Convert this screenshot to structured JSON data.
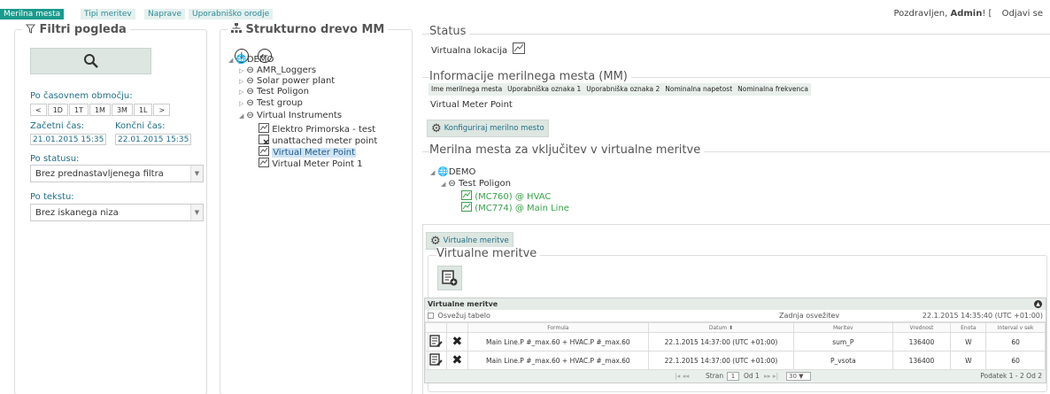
{
  "nav": {
    "tabs": [
      "Merilna mesta",
      "Tipi meritev",
      "Naprave",
      "Uporabniško orodje"
    ],
    "greeting_prefix": "Pozdravljen,",
    "user": "Admin",
    "greeting_suffix": "! [",
    "logout": "Odjavi se"
  },
  "filter": {
    "title": "Filtri pogleda",
    "time_label": "Po časovnem območju:",
    "range_buttons": [
      "<",
      "1D",
      "1T",
      "1M",
      "3M",
      "1L",
      ">"
    ],
    "start_label": "Začetni čas:",
    "end_label": "Končni čas:",
    "start_value": "21.01.2015 15:35",
    "end_value": "22.01.2015 15:35",
    "status_label": "Po statusu:",
    "status_value": "Brez prednastavljenega filtra",
    "text_label": "Po tekstu:",
    "text_value": "Brez iskanega niza"
  },
  "tree": {
    "title": "Strukturno drevo MM",
    "nodes": {
      "root": "DEMO",
      "amr": "AMR_Loggers",
      "solar": "Solar power plant",
      "poligon": "Test Poligon",
      "group": "Test group",
      "virtual": "Virtual Instruments",
      "elektro": "Elektro Primorska - test",
      "unattached": "unattached meter point",
      "vmp": "Virtual Meter Point",
      "vmp1": "Virtual Meter Point 1"
    }
  },
  "status": {
    "title": "Status",
    "value": "Virtualna lokacija"
  },
  "info": {
    "title": "Informacije merilnega mesta (MM)",
    "headers": [
      "Ime merilnega mesta",
      "Uporabniška oznaka 1",
      "Uporabniška oznaka 2",
      "Nominalna napetost",
      "Nominalna frekvenca"
    ],
    "name": "Virtual Meter Point",
    "configure": "Konfiguriraj merilno mesto"
  },
  "include": {
    "title": "Merilna mesta za vključitev v virtualne meritve",
    "root": "DEMO",
    "poligon": "Test Poligon",
    "item1": "(MC760) @ HVAC",
    "item2": "(MC774) @ Main Line"
  },
  "virtual": {
    "tab": "Virtualne meritve",
    "title": "Virtualne meritve",
    "table_title": "Virtualne meritve",
    "refresh": "Osvežuj tabelo",
    "last_refresh": "Zadnja osvežitev",
    "last_refresh_value": "22.1.2015 14:35:40 (UTC +01:00)",
    "columns": [
      "Formula",
      "Datum",
      "Meritev",
      "Vrednost",
      "Enota",
      "Interval v sek"
    ],
    "rows": [
      {
        "formula": "Main Line.P  #_max.60 + HVAC.P  #_max.60",
        "datum": "22.1.2015 14:37:00 (UTC +01:00)",
        "meritev": "sum_P",
        "vrednost": "136400",
        "enota": "W",
        "interval": "60"
      },
      {
        "formula": "Main Line.P  #_max.60 + HVAC.P  #_max.60",
        "datum": "22.1.2015 14:37:00 (UTC +01:00)",
        "meritev": "P_vsota",
        "vrednost": "136400",
        "enota": "W",
        "interval": "60"
      }
    ],
    "pager": {
      "page_label": "Stran",
      "page": "1",
      "of": "Od 1",
      "per_page": "30",
      "records": "Podatek 1 - 2 Od 2"
    }
  },
  "colors": {
    "accent": "#1b9a8c",
    "link": "#1f6e86",
    "green": "#3aa04a"
  }
}
